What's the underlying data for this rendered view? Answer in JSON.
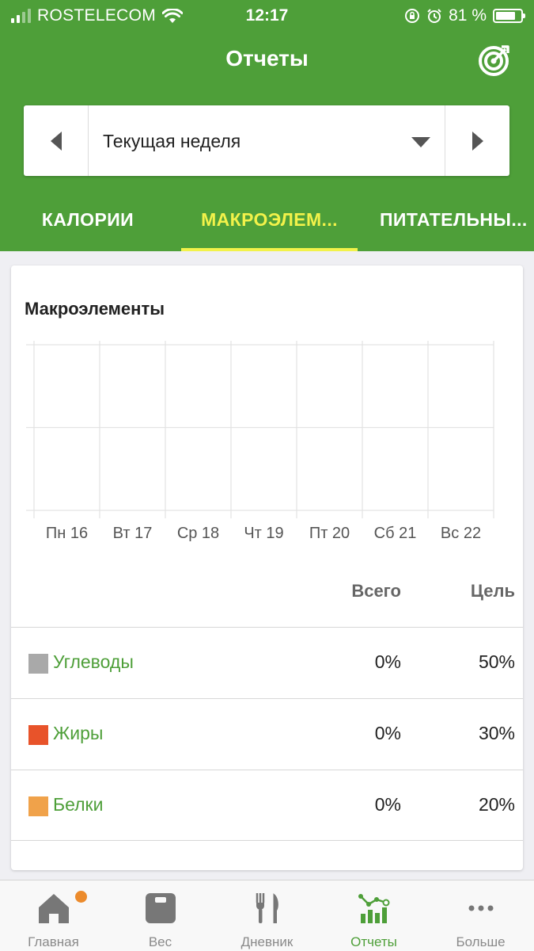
{
  "status_bar": {
    "carrier": "ROSTELECOM",
    "time": "12:17",
    "battery": "81 %",
    "battery_level": 0.81
  },
  "header": {
    "title": "Отчеты"
  },
  "date_selector": {
    "label": "Текущая неделя"
  },
  "tabs": [
    {
      "label": "КАЛОРИИ",
      "active": false
    },
    {
      "label": "МАКРОЭЛЕМ...",
      "active": true
    },
    {
      "label": "ПИТАТЕЛЬНЫ...",
      "active": false
    }
  ],
  "card": {
    "title": "Макроэлементы",
    "columns": {
      "total": "Всего",
      "goal": "Цель"
    },
    "rows": [
      {
        "name": "Углеводы",
        "total": "0%",
        "goal": "50%",
        "color": "#a9a9a9"
      },
      {
        "name": "Жиры",
        "total": "0%",
        "goal": "30%",
        "color": "#e8532a"
      },
      {
        "name": "Белки",
        "total": "0%",
        "goal": "20%",
        "color": "#f0a24a"
      }
    ]
  },
  "chart_data": {
    "type": "bar",
    "categories": [
      "Пн 16",
      "Вт 17",
      "Ср 18",
      "Чт 19",
      "Пт 20",
      "Сб 21",
      "Вс 22"
    ],
    "series": [],
    "grid": true
  },
  "bottom_nav": [
    {
      "label": "Главная",
      "icon": "home-icon",
      "badge": true
    },
    {
      "label": "Вес",
      "icon": "scale-icon"
    },
    {
      "label": "Дневник",
      "icon": "fork-knife-icon"
    },
    {
      "label": "Отчеты",
      "icon": "reports-chart-icon",
      "active": true
    },
    {
      "label": "Больше",
      "icon": "more-dots-icon"
    }
  ],
  "colors": {
    "brand_green": "#4e9f39",
    "tab_highlight": "#f2f24a",
    "badge_orange": "#ec8b2c"
  }
}
